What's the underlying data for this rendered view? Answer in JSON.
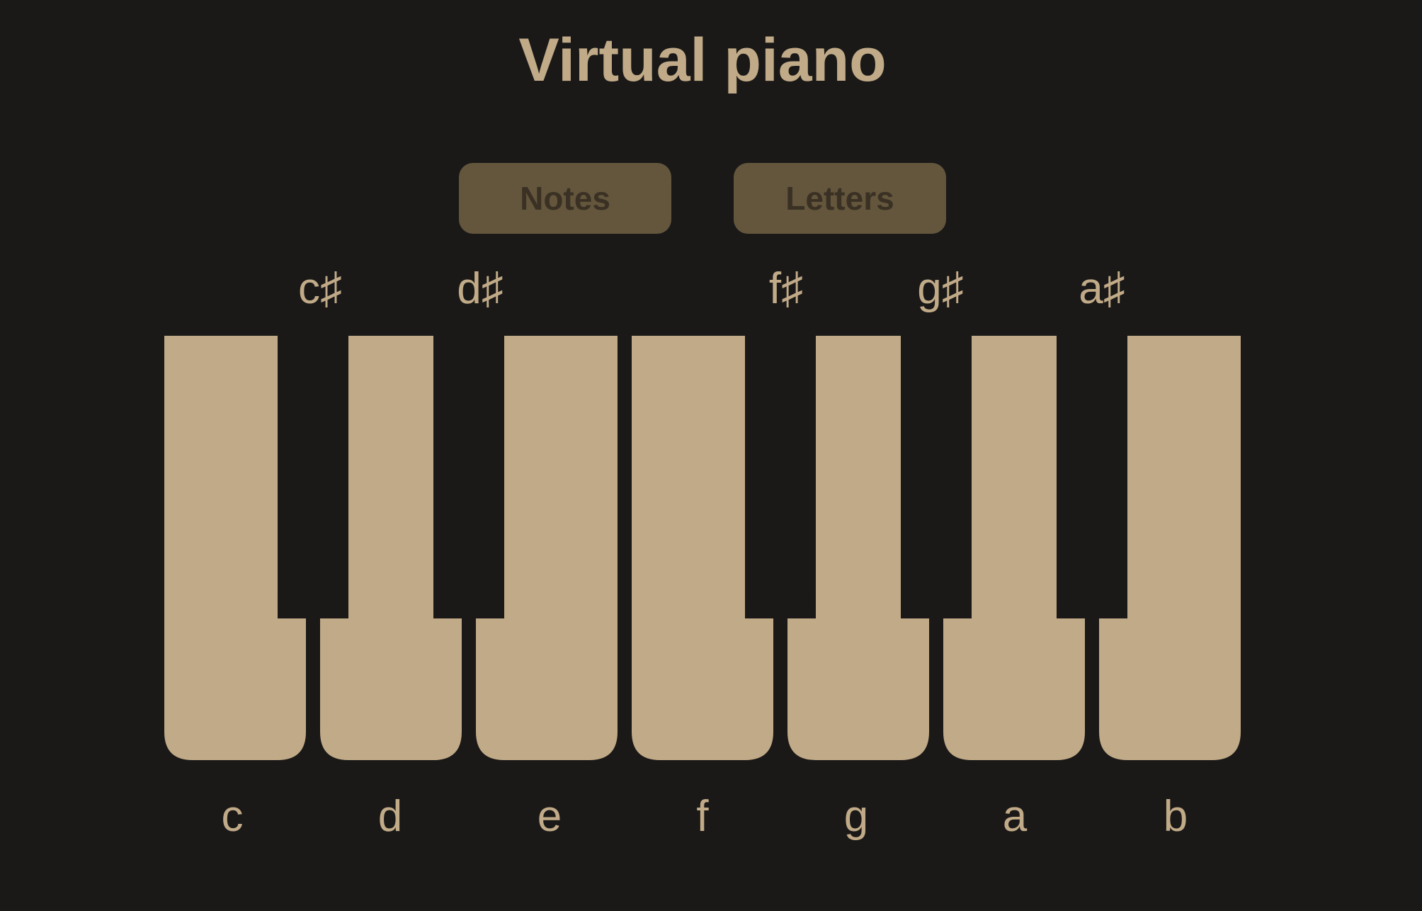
{
  "app": {
    "title": "Virtual piano"
  },
  "mode_buttons": {
    "notes_label": "Notes",
    "letters_label": "Letters"
  },
  "keyboard": {
    "white_keys": [
      "c",
      "d",
      "e",
      "f",
      "g",
      "a",
      "b"
    ],
    "black_keys": [
      "c♯",
      "d♯",
      "f♯",
      "g♯",
      "a♯"
    ]
  },
  "colors": {
    "background": "#1a1918",
    "key": "#c1aa87",
    "button_fill": "#63563c",
    "button_text": "#3a3124"
  }
}
